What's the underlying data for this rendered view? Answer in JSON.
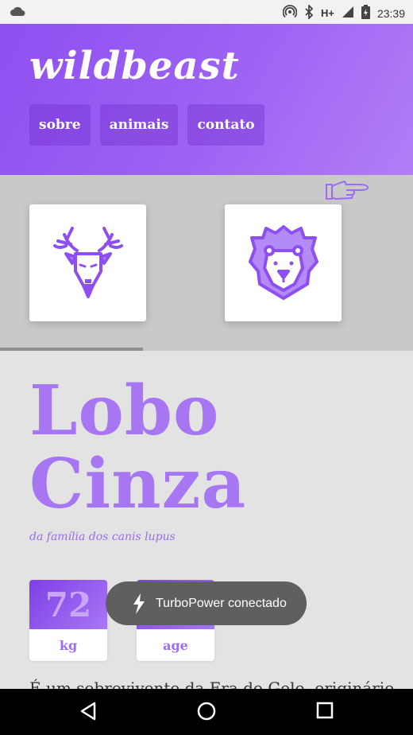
{
  "status_bar": {
    "network_type": "H+",
    "time": "23:39",
    "icons": [
      "cloud-icon",
      "hotspot-icon",
      "bluetooth-icon",
      "signal-icon",
      "battery-charging-icon"
    ]
  },
  "header": {
    "logo": "wildbeast",
    "nav": [
      {
        "label": "sobre"
      },
      {
        "label": "animais"
      },
      {
        "label": "contato"
      }
    ]
  },
  "carousel": {
    "items": [
      {
        "icon": "deer-icon"
      },
      {
        "icon": "lion-icon"
      }
    ],
    "hint_icon": "pointing-hand-icon"
  },
  "animal": {
    "name_line1": "Lobo",
    "name_line2": "Cinza",
    "family": "da família dos canis lupus",
    "stats": [
      {
        "value": "72",
        "unit": "kg"
      },
      {
        "value": "",
        "unit": "age"
      }
    ],
    "description": "É um sobrevivente da Era do Gelo, originário"
  },
  "toast": {
    "message": "TurboPower conectado",
    "icon": "lightning-icon"
  },
  "nav_bar": {
    "buttons": [
      "back-icon",
      "home-icon",
      "recents-icon"
    ]
  },
  "colors": {
    "accent": "#9b5cf3",
    "title": "#a776f2"
  }
}
